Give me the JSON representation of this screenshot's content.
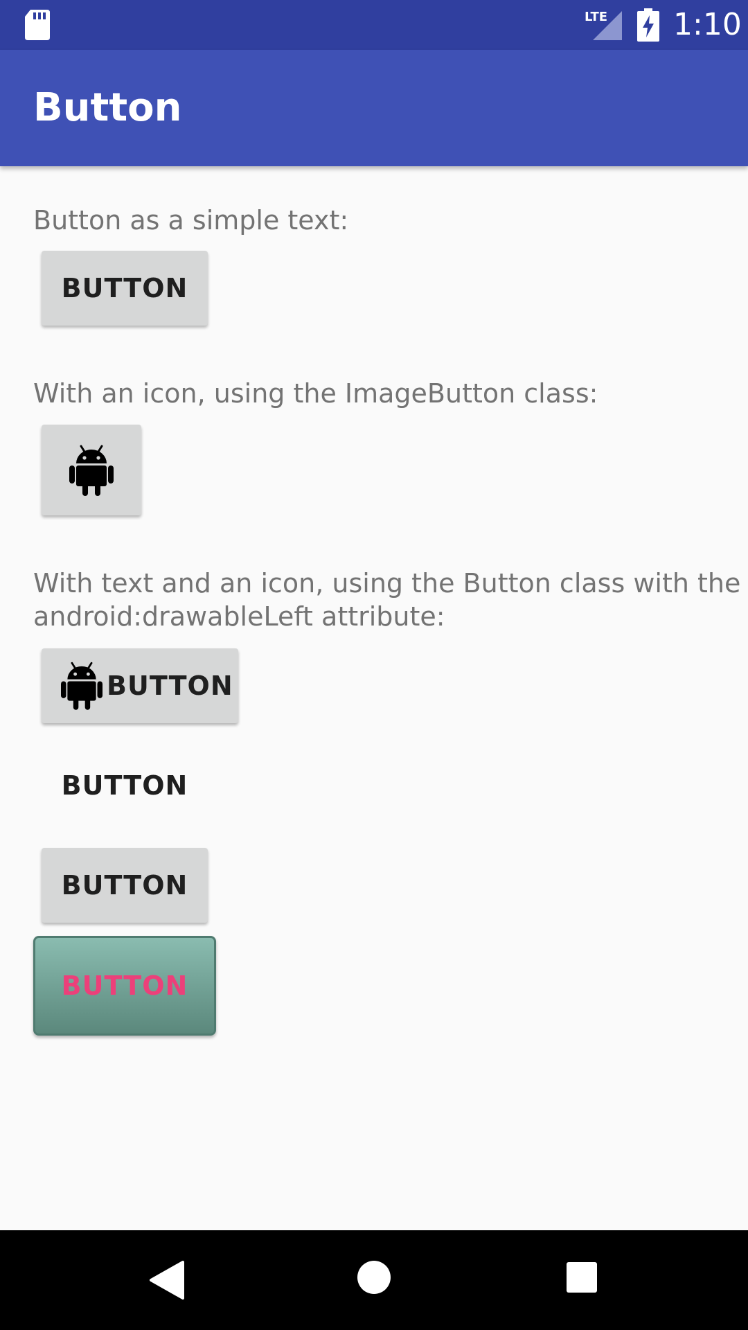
{
  "status_bar": {
    "time": "1:10",
    "network": "LTE",
    "icons": [
      "sd-card-icon",
      "signal-icon",
      "battery-charging-icon"
    ]
  },
  "app_bar": {
    "title": "Button",
    "color": "#3f51b5"
  },
  "content": {
    "label_simple": "Button as a simple text:",
    "simple_button": "BUTTON",
    "label_image": "With an icon, using the ImageButton class:",
    "image_button_icon": "android-icon",
    "label_text_icon_line1": "With text and an icon, using the Button class with the",
    "label_text_icon_line2": "android:drawableLeft attribute:",
    "text_icon_button": "BUTTON",
    "flat_button": "BUTTON",
    "raised_button": "BUTTON",
    "custom_button": "BUTTON",
    "custom_button_text_color": "#ec407a"
  },
  "nav_bar": {
    "back": "back-icon",
    "home": "home-icon",
    "recents": "recents-icon"
  }
}
